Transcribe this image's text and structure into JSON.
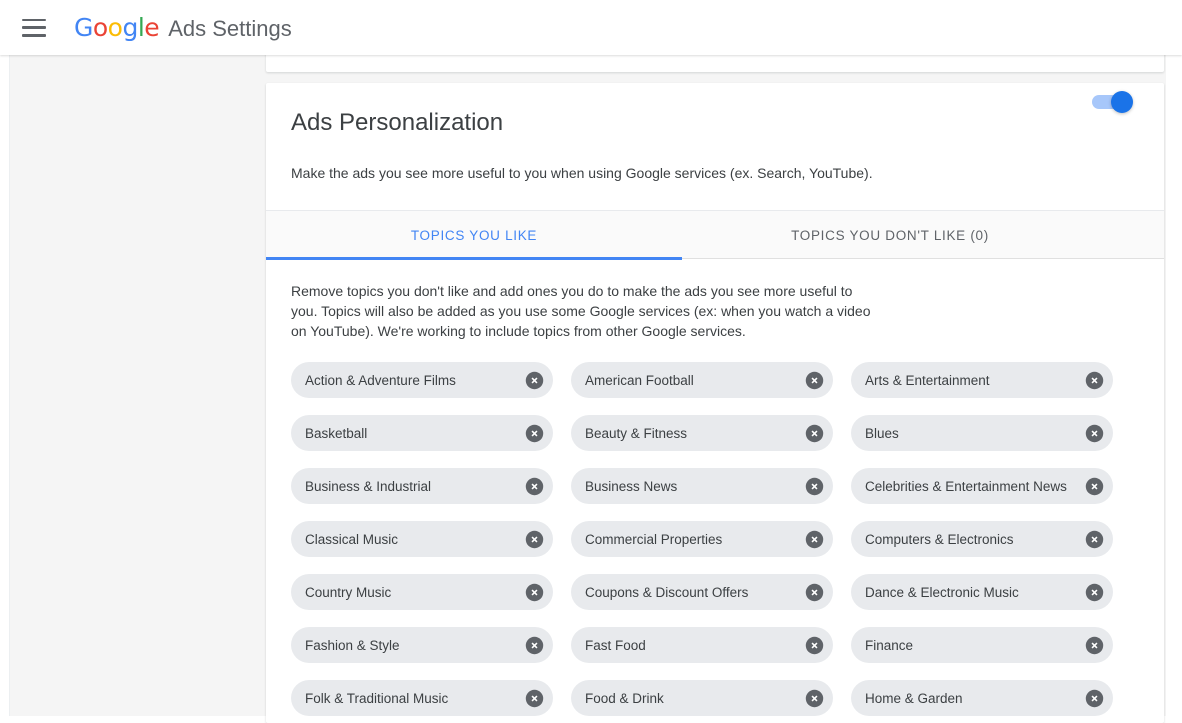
{
  "appbar": {
    "menu_icon": "hamburger-menu-icon",
    "logo": {
      "letters": [
        "G",
        "o",
        "o",
        "g",
        "l",
        "e"
      ]
    },
    "product_name": "Ads Settings"
  },
  "card": {
    "title": "Ads Personalization",
    "description": "Make the ads you see more useful to you when using Google services (ex. Search, YouTube).",
    "toggle": {
      "name": "ads-personalization-toggle",
      "state": "on",
      "track_color": "#8ab4f8",
      "thumb_color": "#1a73e8"
    }
  },
  "tabs": [
    {
      "label": "TOPICS YOU LIKE",
      "active": true
    },
    {
      "label": "TOPICS YOU DON'T LIKE (0)",
      "active": false
    }
  ],
  "accent_color": "#4285f4",
  "topics_panel": {
    "intro": "Remove topics you don't like and add ones you do to make the ads you see more useful to you. Topics will also be added as you use some Google services (ex: when you watch a video on YouTube). We're working to include topics from other Google services.",
    "remove_icon": "close-circle-icon",
    "chips": [
      "Action & Adventure Films",
      "American Football",
      "Arts & Entertainment",
      "Basketball",
      "Beauty & Fitness",
      "Blues",
      "Business & Industrial",
      "Business News",
      "Celebrities & Entertainment News",
      "Classical Music",
      "Commercial Properties",
      "Computers & Electronics",
      "Country Music",
      "Coupons & Discount Offers",
      "Dance & Electronic Music",
      "Fashion & Style",
      "Fast Food",
      "Finance",
      "Folk & Traditional Music",
      "Food & Drink",
      "Home & Garden"
    ]
  }
}
